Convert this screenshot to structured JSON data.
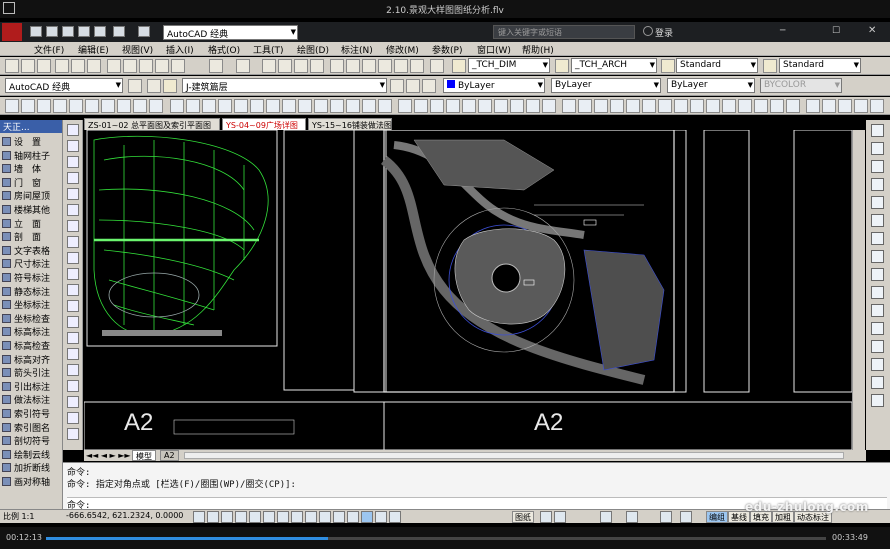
{
  "player": {
    "title": "2.10.景观大样图图纸分析.flv",
    "time_current": "00:12:13",
    "time_total": "00:33:49",
    "progress": 0.361
  },
  "acad": {
    "workspace": "AutoCAD 经典",
    "search_placeholder": "键入关键字或短语",
    "login": "登录",
    "menus": [
      "文件(F)",
      "编辑(E)",
      "视图(V)",
      "插入(I)",
      "格式(O)",
      "工具(T)",
      "绘图(D)",
      "标注(N)",
      "修改(M)",
      "参数(P)",
      "窗口(W)",
      "帮助(H)"
    ],
    "dim_style": "_TCH_DIM",
    "text_style": "_TCH_ARCH",
    "table_style": "Standard",
    "multileader_style": "Standard",
    "workspace2": "AutoCAD 经典",
    "layer": "J-建筑篇层",
    "color": "ByLayer",
    "linetype": "ByLayer",
    "lineweight": "ByLayer",
    "plotstyle": "BYCOLOR",
    "palette_title": "天正...",
    "palette_items": [
      "设　置",
      "轴网柱子",
      "墙　体",
      "门　窗",
      "房间屋顶",
      "楼梯其他",
      "立　面",
      "剖　面",
      "文字表格",
      "尺寸标注",
      "符号标注",
      "静态标注",
      "坐标标注",
      "坐标检查",
      "标高标注",
      "标高检查",
      "标高对齐",
      "箭头引注",
      "引出标注",
      "做法标注",
      "索引符号",
      "索引图名",
      "剖切符号",
      "绘制云线",
      "加折断线",
      "画对称轴"
    ],
    "drawing_tabs": [
      "ZS-01~02 总平面图及索引平面图",
      "YS-04~09广场详图",
      "YS-15~16铺装做法图"
    ],
    "layout_tabs": [
      "模型",
      "A2"
    ],
    "sheet_labels": [
      "A2",
      "A2"
    ],
    "command_lines": [
      "命令:",
      "命令: 指定对角点或 [栏选(F)/圈围(WP)/圈交(CP)]:",
      "命令:"
    ],
    "scale": "比例 1:1",
    "coords": "-666.6542, 621.2324, 0.0000",
    "status_buttons": [
      "图纸",
      "编组",
      "基线",
      "填充",
      "加粗",
      "动态标注"
    ],
    "watermark": "edu-zhulong.com"
  },
  "colors": {
    "accent": "#2f8de0",
    "linework_green": "#33e03a",
    "linework_blue": "#3c4fd8"
  }
}
